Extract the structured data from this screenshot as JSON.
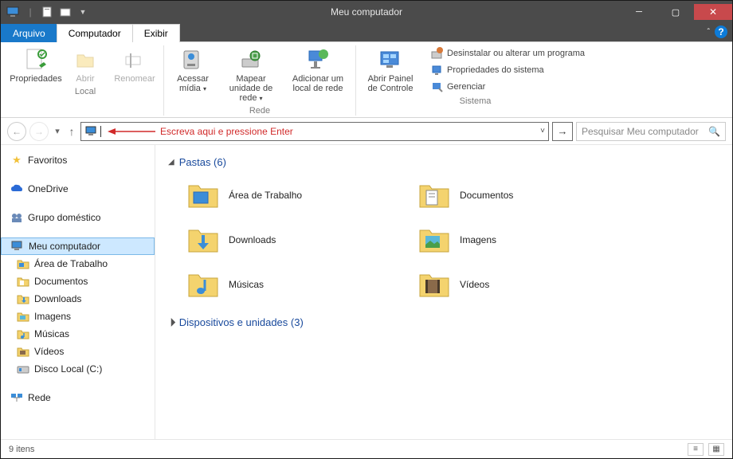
{
  "window": {
    "title": "Meu computador"
  },
  "tabs": {
    "file": "Arquivo",
    "computer": "Computador",
    "view": "Exibir"
  },
  "ribbon": {
    "local": {
      "label": "Local",
      "properties": "Propriedades",
      "open": "Abrir",
      "rename": "Renomear"
    },
    "network": {
      "label": "Rede",
      "access_media": "Acessar mídia",
      "map_drive": "Mapear unidade de rede",
      "add_location": "Adicionar um local de rede"
    },
    "system": {
      "label": "Sistema",
      "control_panel": "Abrir Painel de Controle",
      "uninstall": "Desinstalar ou alterar um programa",
      "sys_props": "Propriedades do sistema",
      "manage": "Gerenciar"
    }
  },
  "addressbar": {
    "hint": "Escreva aqui e pressione Enter"
  },
  "search": {
    "placeholder": "Pesquisar Meu computador"
  },
  "sidebar": {
    "favorites": "Favoritos",
    "onedrive": "OneDrive",
    "homegroup": "Grupo doméstico",
    "my_computer": "Meu computador",
    "desktop": "Área de Trabalho",
    "documents": "Documentos",
    "downloads": "Downloads",
    "images": "Imagens",
    "music": "Músicas",
    "videos": "Vídeos",
    "local_disk": "Disco Local (C:)",
    "network": "Rede"
  },
  "content": {
    "folders_header": "Pastas (6)",
    "devices_header": "Dispositivos e unidades (3)",
    "folders": {
      "desktop": "Área de Trabalho",
      "documents": "Documentos",
      "downloads": "Downloads",
      "images": "Imagens",
      "music": "Músicas",
      "videos": "Vídeos"
    }
  },
  "status": {
    "items": "9 itens"
  }
}
